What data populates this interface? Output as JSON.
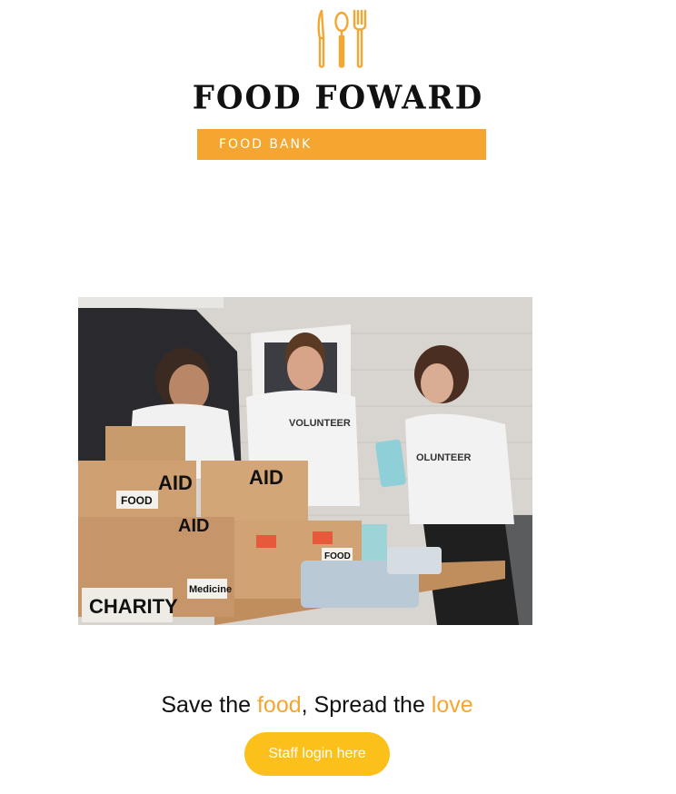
{
  "brand": {
    "title": "FOOD FOWARD",
    "subtitle": "FOOD BANK",
    "logo_icon": "knife-spoon-fork-icon",
    "accent_color": "#f5a630"
  },
  "hero": {
    "image_description_icon": "volunteers-photo",
    "box_labels": [
      "AID",
      "AID",
      "FOOD",
      "FOOD",
      "CHARITY",
      "Medicine"
    ],
    "shirt_text": "VOLUNTEER"
  },
  "tagline": {
    "part1": "Save the ",
    "word1": "food",
    "part2": ", Spread the ",
    "word2": "love"
  },
  "login": {
    "label": "Staff login here",
    "color": "#fbc019"
  }
}
